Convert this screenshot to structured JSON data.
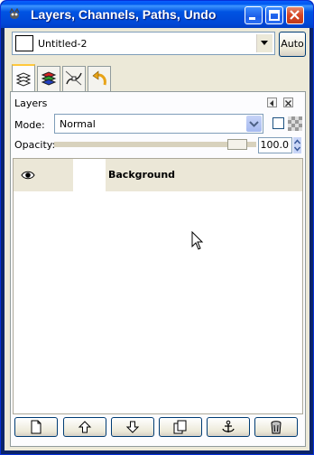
{
  "window": {
    "title": "Layers, Channels, Paths, Undo",
    "title_color": "#ffffff",
    "titlebar_color": "#0054e3"
  },
  "image_selector": {
    "value": "Untitled-2",
    "auto_label": "Auto"
  },
  "tabs": [
    {
      "name": "layers",
      "icon": "layers-icon",
      "active": true
    },
    {
      "name": "channels",
      "icon": "channels-icon",
      "active": false
    },
    {
      "name": "paths",
      "icon": "paths-icon",
      "active": false
    },
    {
      "name": "undo",
      "icon": "undo-icon",
      "active": false
    }
  ],
  "layers_panel": {
    "title": "Layers",
    "mode_label": "Mode:",
    "mode_value": "Normal",
    "opacity_label": "Opacity:",
    "opacity_value": "100.0",
    "opacity_fraction": 1.0,
    "lock_alpha_checked": false,
    "layers": [
      {
        "name": "Background",
        "visible": true,
        "selected": true
      }
    ],
    "buttons": [
      "new-layer-icon",
      "raise-layer-icon",
      "lower-layer-icon",
      "duplicate-layer-icon",
      "anchor-layer-icon",
      "delete-layer-icon"
    ]
  }
}
